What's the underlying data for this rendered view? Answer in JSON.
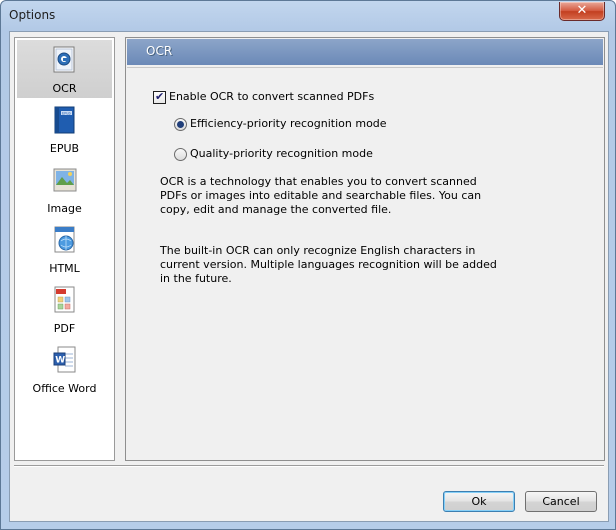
{
  "window": {
    "title": "Options",
    "close_glyph": "✕"
  },
  "sidebar": {
    "items": [
      {
        "label": "OCR",
        "icon": "ocr-icon",
        "selected": true
      },
      {
        "label": "EPUB",
        "icon": "epub-icon",
        "selected": false
      },
      {
        "label": "Image",
        "icon": "image-icon",
        "selected": false
      },
      {
        "label": "HTML",
        "icon": "html-icon",
        "selected": false
      },
      {
        "label": "PDF",
        "icon": "pdf-icon",
        "selected": false
      },
      {
        "label": "Office Word",
        "icon": "word-icon",
        "selected": false
      }
    ]
  },
  "panel": {
    "header": "OCR",
    "enable_ocr": {
      "label": "Enable OCR to convert scanned PDFs",
      "checked": true
    },
    "modes": [
      {
        "label": "Efficiency-priority recognition mode",
        "selected": true
      },
      {
        "label": "Quality-priority recognition mode",
        "selected": false
      }
    ],
    "description": "OCR is a technology that enables you to convert scanned PDFs or images into editable and searchable files. You can copy, edit and manage the converted file.",
    "note": "The built-in OCR can only recognize English characters in current version. Multiple languages recognition will be added in the future."
  },
  "buttons": {
    "ok": "Ok",
    "cancel": "Cancel"
  },
  "colors": {
    "header_blue": "#7a95c1",
    "selected_item": "#d6d6d6",
    "default_button_border": "#3c7fb1"
  }
}
